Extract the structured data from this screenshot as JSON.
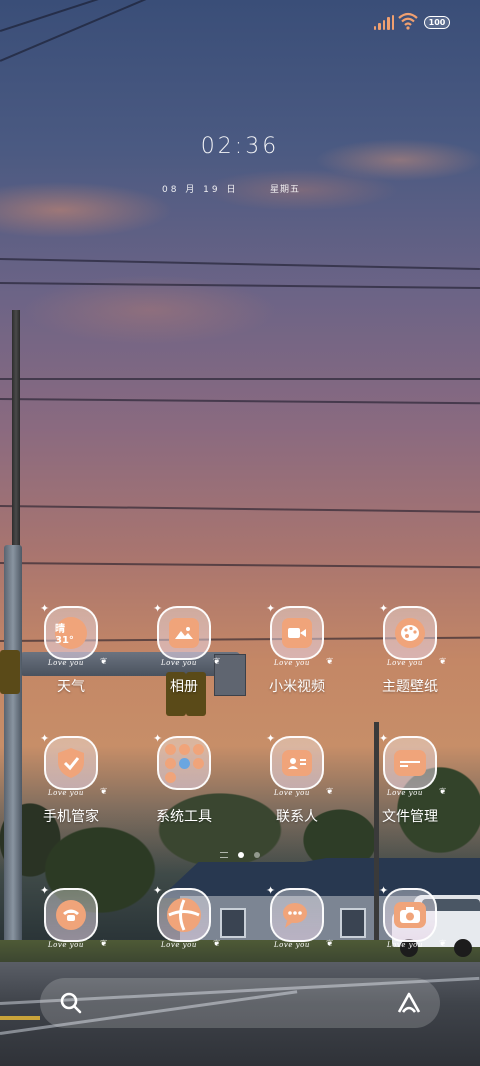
{
  "status_bar": {
    "battery_level": "100",
    "icons": [
      "cellular-signal-icon",
      "wifi-icon",
      "battery-icon"
    ]
  },
  "lock_widget": {
    "time": "02:36",
    "date": "08 月 19 日",
    "weekday": "星期五"
  },
  "apps_row1": [
    {
      "label": "天气",
      "icon": "weather-icon",
      "extra": "晴 31°"
    },
    {
      "label": "相册",
      "icon": "gallery-icon"
    },
    {
      "label": "小米视频",
      "icon": "video-icon"
    },
    {
      "label": "主题壁纸",
      "icon": "palette-icon"
    }
  ],
  "apps_row2": [
    {
      "label": "手机管家",
      "icon": "shield-icon"
    },
    {
      "label": "系统工具",
      "icon": "tools-folder-icon"
    },
    {
      "label": "联系人",
      "icon": "contacts-icon"
    },
    {
      "label": "文件管理",
      "icon": "folder-icon"
    }
  ],
  "dock": [
    {
      "label": "",
      "icon": "phone-icon"
    },
    {
      "label": "",
      "icon": "browser-icon"
    },
    {
      "label": "",
      "icon": "messages-icon"
    },
    {
      "label": "",
      "icon": "camera-icon"
    }
  ],
  "icon_decoration": {
    "caption": "Love you"
  },
  "pager": {
    "pages": 2,
    "active": 0
  },
  "colors": {
    "accent": "#f0a47a",
    "icon_border": "#ffffff"
  }
}
